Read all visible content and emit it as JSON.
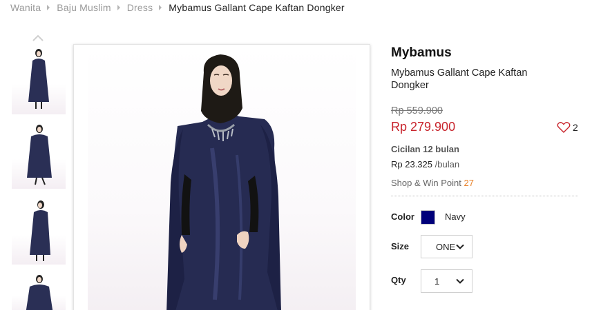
{
  "breadcrumb": {
    "items": [
      "Wanita",
      "Baju Muslim",
      "Dress"
    ],
    "current": "Mybamus Gallant Cape Kaftan Dongker"
  },
  "product": {
    "brand": "Mybamus",
    "name": "Mybamus Gallant Cape Kaftan Dongker",
    "old_price": "Rp 559.900",
    "sale_price": "Rp 279.900",
    "wishlist_count": "2",
    "installment_title": "Cicilan 12 bulan",
    "installment_amount": "Rp 23.325",
    "installment_unit": "/bulan",
    "point_label": "Shop & Win Point",
    "point_value": "27"
  },
  "options": {
    "color_label": "Color",
    "color_name": "Navy",
    "color_hex": "#00007a",
    "size_label": "Size",
    "size_value": "ONE",
    "qty_label": "Qty",
    "qty_value": "1"
  },
  "icons": {
    "thumb_up": "chevron-up-icon",
    "wishlist": "heart-icon",
    "dropdown": "chevron-down-icon"
  },
  "colors": {
    "sale_price": "#c8242c",
    "point_value": "#e8822a",
    "dress": "#2a2f55"
  }
}
